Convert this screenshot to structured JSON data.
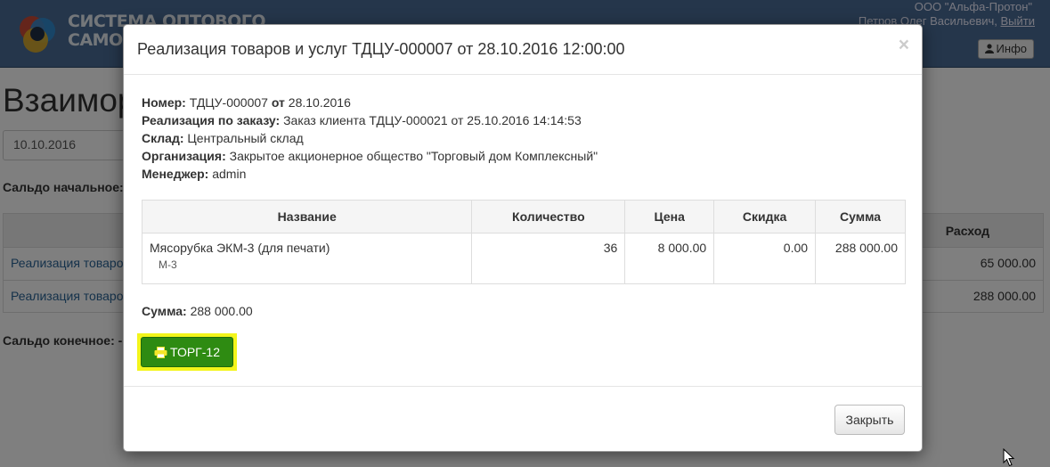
{
  "navbar": {
    "logo_text": "СИСТЕМА ОПТОВОГО\nСАМООБСЛУЖИВАНИЯ",
    "company": "ООО \"Альфа-Протон\"",
    "user_name": "Петров Олег Васильевич,",
    "logout": "Выйти",
    "info_button": "Инфо"
  },
  "page": {
    "title": "Взаимор",
    "date_value": "10.10.2016",
    "saldo_start": "Сальдо начальное:",
    "saldo_end": "Сальдо конечное: -",
    "table": {
      "column_expense": "Расход",
      "rows": [
        {
          "doc": "Реализация товаро",
          "expense": "65 000.00"
        },
        {
          "doc": "Реализация товаро",
          "expense": "288 000.00"
        }
      ]
    }
  },
  "modal": {
    "title": "Реализация товаров и услуг ТДЦУ-000007 от 28.10.2016 12:00:00",
    "close_symbol": "×",
    "fields": {
      "number_label": "Номер:",
      "number_value": "ТДЦУ-000007",
      "from_label": "от",
      "date_value": "28.10.2016",
      "order_label": "Реализация по заказу:",
      "order_value": "Заказ клиента ТДЦУ-000021 от 25.10.2016 14:14:53",
      "warehouse_label": "Склад:",
      "warehouse_value": "Центральный склад",
      "org_label": "Организация:",
      "org_value": "Закрытое акционерное общество \"Торговый дом Комплексный\"",
      "manager_label": "Менеджер:",
      "manager_value": "admin"
    },
    "goods_table": {
      "headers": [
        "Название",
        "Количество",
        "Цена",
        "Скидка",
        "Сумма"
      ],
      "rows": [
        {
          "name": "Мясорубка ЭКМ-3 (для печати)",
          "article": "М-3",
          "quantity": "36",
          "price": "8 000.00",
          "discount": "0.00",
          "sum": "288 000.00"
        }
      ]
    },
    "total_label": "Сумма:",
    "total_value": "288 000.00",
    "print_button": "ТОРГ-12",
    "close_button": "Закрыть"
  },
  "colors": {
    "navbar": "#4b6d96",
    "print_button": "#2e8b12",
    "highlight": "#f3f51b",
    "link": "#2a6496"
  },
  "icons": [
    "logo-icon",
    "user-icon",
    "printer-icon",
    "close-icon",
    "mouse-cursor-icon"
  ]
}
